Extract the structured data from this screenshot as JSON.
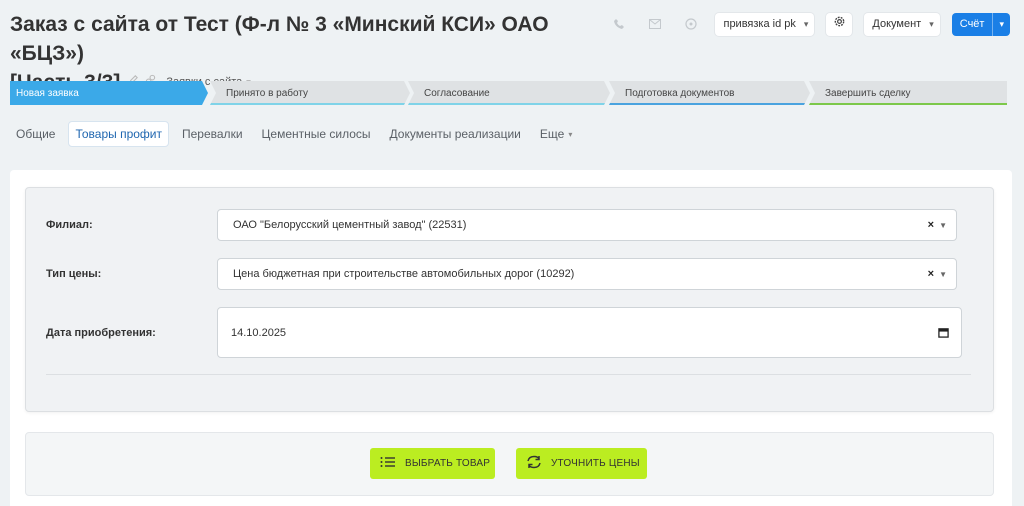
{
  "header": {
    "title_line1": "Заказ с сайта от Тест (Ф-л № 3 «Минский КСИ» ОАО «БЦЗ»)",
    "title_line2": "[Часть 3/3]",
    "category": "Заявки с сайта"
  },
  "toolbar": {
    "binding_label": "привязка id pk",
    "document_label": "Документ",
    "bill_label": "Счёт"
  },
  "stages": [
    {
      "label": "Новая заявка",
      "color": "#3ba9e8"
    },
    {
      "label": "Принято в работу",
      "color": "#7fd3e8"
    },
    {
      "label": "Согласование",
      "color": "#7fd3e8"
    },
    {
      "label": "Подготовка документов",
      "color": "#4aa3df"
    },
    {
      "label": "Завершить сделку",
      "color": "#7cc84a"
    }
  ],
  "tabs": [
    {
      "label": "Общие",
      "active": false
    },
    {
      "label": "Товары профит",
      "active": true
    },
    {
      "label": "Перевалки",
      "active": false
    },
    {
      "label": "Цементные силосы",
      "active": false
    },
    {
      "label": "Документы реализации",
      "active": false
    },
    {
      "label": "Еще",
      "active": false
    }
  ],
  "form": {
    "branch_label": "Филиал:",
    "branch_value": "ОАО \"Белорусский цементный завод\" (22531)",
    "price_type_label": "Тип цены:",
    "price_type_value": "Цена бюджетная при строительстве автомобильных дорог (10292)",
    "purchase_date_label": "Дата приобретения:",
    "purchase_date_value": "14.10.2025"
  },
  "actions": {
    "select_product_label": "ВЫБРАТЬ ТОВАР",
    "update_prices_label": "УТОЧНИТЬ ЦЕНЫ"
  }
}
